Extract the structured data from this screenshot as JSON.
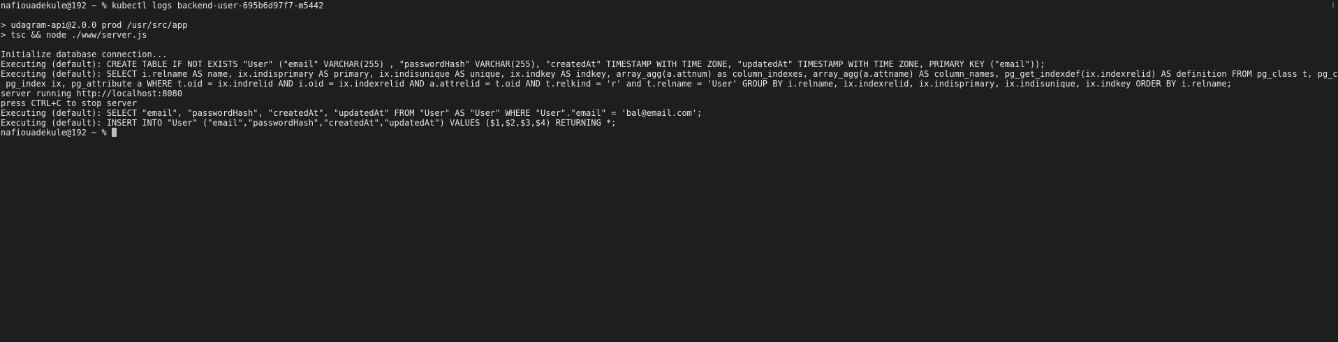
{
  "terminal": {
    "lines": [
      "nafiouadekule@192 ~ % kubectl logs backend-user-695b6d97f7-m5442",
      "",
      "> udagram-api@2.0.0 prod /usr/src/app",
      "> tsc && node ./www/server.js",
      "",
      "Initialize database connection...",
      "Executing (default): CREATE TABLE IF NOT EXISTS \"User\" (\"email\" VARCHAR(255) , \"passwordHash\" VARCHAR(255), \"createdAt\" TIMESTAMP WITH TIME ZONE, \"updatedAt\" TIMESTAMP WITH TIME ZONE, PRIMARY KEY (\"email\"));",
      "Executing (default): SELECT i.relname AS name, ix.indisprimary AS primary, ix.indisunique AS unique, ix.indkey AS indkey, array_agg(a.attnum) as column_indexes, array_agg(a.attname) AS column_names, pg_get_indexdef(ix.indexrelid) AS definition FROM pg_class t, pg_class i,",
      " pg_index ix, pg_attribute a WHERE t.oid = ix.indrelid AND i.oid = ix.indexrelid AND a.attrelid = t.oid AND t.relkind = 'r' and t.relname = 'User' GROUP BY i.relname, ix.indexrelid, ix.indisprimary, ix.indisunique, ix.indkey ORDER BY i.relname;",
      "server running http://localhost:8080",
      "press CTRL+C to stop server",
      "Executing (default): SELECT \"email\", \"passwordHash\", \"createdAt\", \"updatedAt\" FROM \"User\" AS \"User\" WHERE \"User\".\"email\" = 'bal@email.com';",
      "Executing (default): INSERT INTO \"User\" (\"email\",\"passwordHash\",\"createdAt\",\"updatedAt\") VALUES ($1,$2,$3,$4) RETURNING *;"
    ],
    "prompt": "nafiouadekule@192 ~ % "
  },
  "colors": {
    "background": "#1e1e1e",
    "foreground": "#e6e6e6",
    "cursor": "#bdbdbd"
  }
}
